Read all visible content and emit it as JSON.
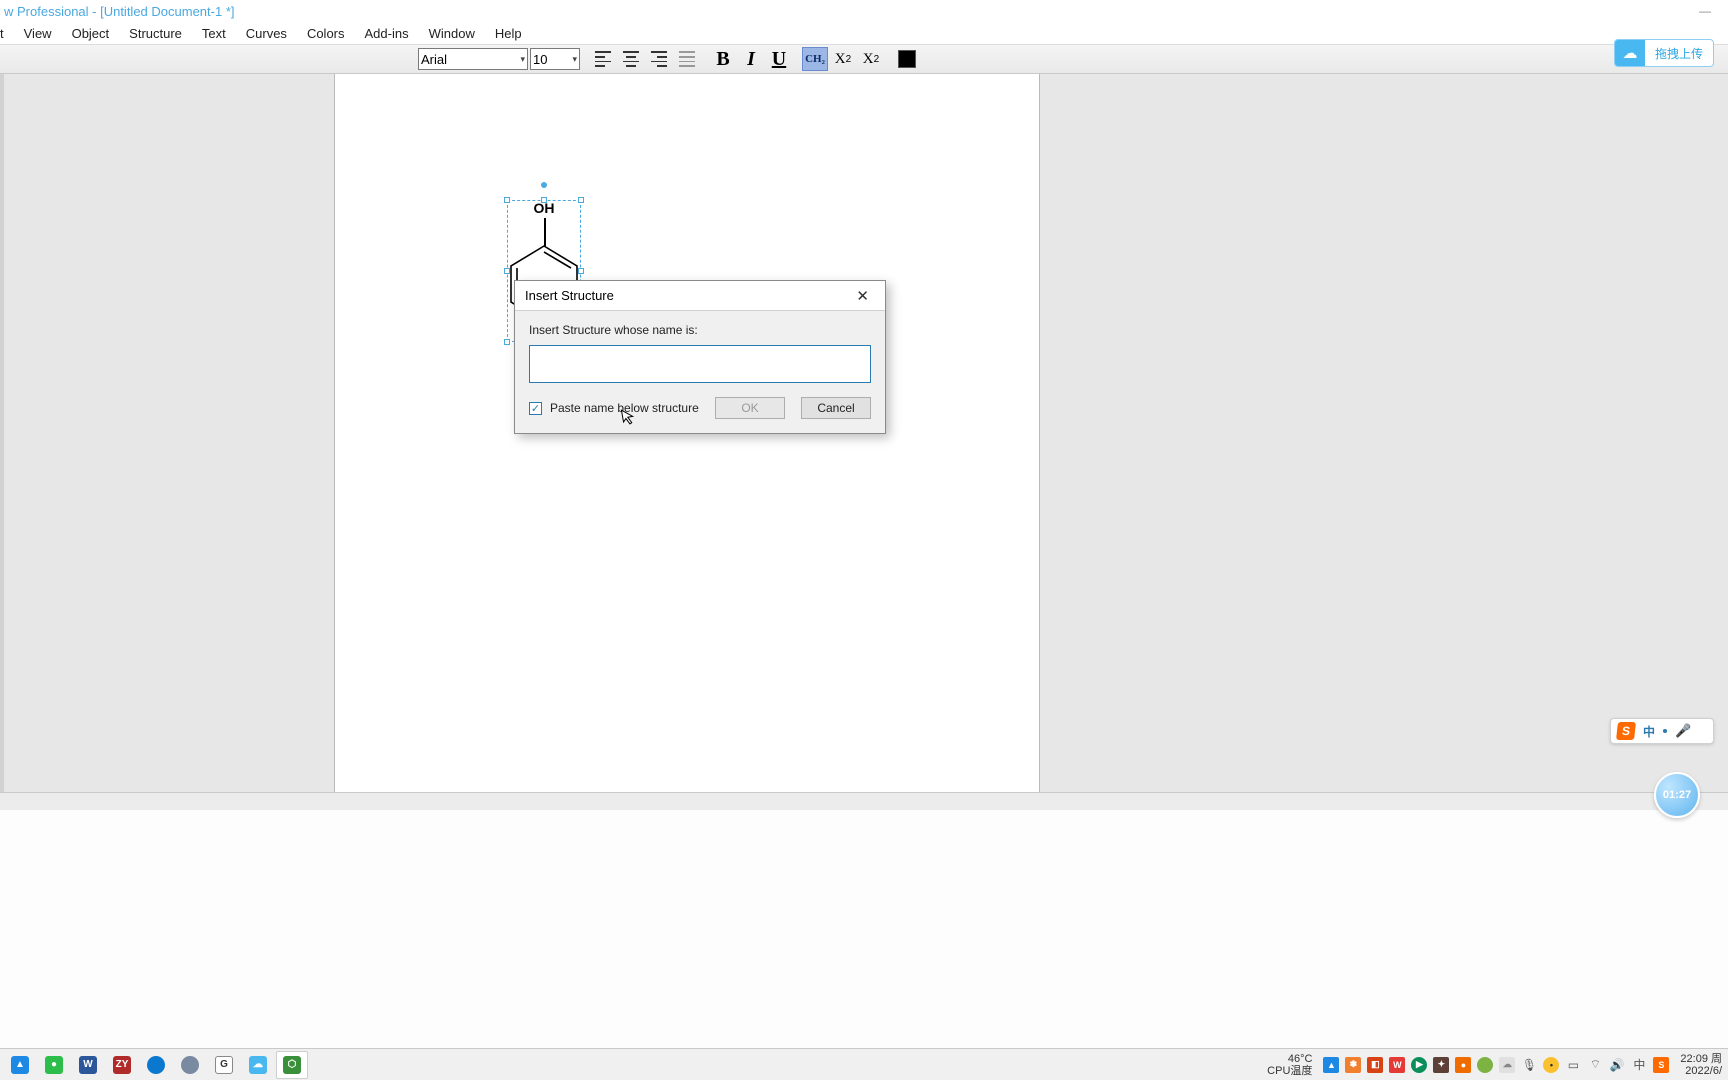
{
  "window": {
    "title": "w Professional - [Untitled Document-1 *]"
  },
  "menu": {
    "items": [
      "t",
      "View",
      "Object",
      "Structure",
      "Text",
      "Curves",
      "Colors",
      "Add-ins",
      "Window",
      "Help"
    ]
  },
  "toolbar": {
    "font": "Arial",
    "size": "10",
    "upload_label": "拖拽上传"
  },
  "structure": {
    "label_top": "OH"
  },
  "dialog": {
    "title": "Insert Structure",
    "prompt": "Insert Structure whose name is:",
    "name_value": "",
    "paste_label": "Paste name below structure",
    "paste_checked": true,
    "ok": "OK",
    "cancel": "Cancel"
  },
  "ime": {
    "logo": "S",
    "lang": "中"
  },
  "timer": "01:27",
  "system": {
    "temp_line1": "46°C",
    "temp_line2": "CPU温度",
    "time": "22:09",
    "time_suffix": "周",
    "date": "2022/6/"
  }
}
